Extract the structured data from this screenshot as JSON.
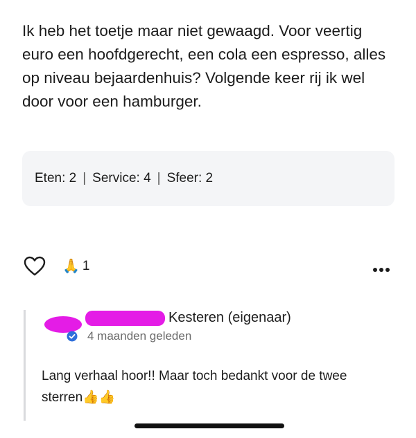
{
  "review": {
    "text": "Ik heb het toetje maar niet gewaagd. Voor veertig euro een hoofdgerecht, een cola een espresso, alles op niveau bejaardenhuis? Volgende keer rij ik wel door voor een hamburger.",
    "ratings": [
      {
        "label": "Eten: 2"
      },
      {
        "label": "Service: 4"
      },
      {
        "label": "Sfeer: 2"
      }
    ],
    "separator": "|"
  },
  "actions": {
    "reaction_emoji": "🙏",
    "reaction_count": "1",
    "heart_icon": "heart-icon",
    "more_icon": "more-options-icon"
  },
  "owner_reply": {
    "name": "Kesteren (eigenaar)",
    "time": "4 maanden geleden",
    "text": "Lang verhaal hoor!! Maar toch bedankt voor de twee sterren👍👍",
    "redaction_color": "#e41ce6",
    "verified_color": "#2f6fdb"
  }
}
